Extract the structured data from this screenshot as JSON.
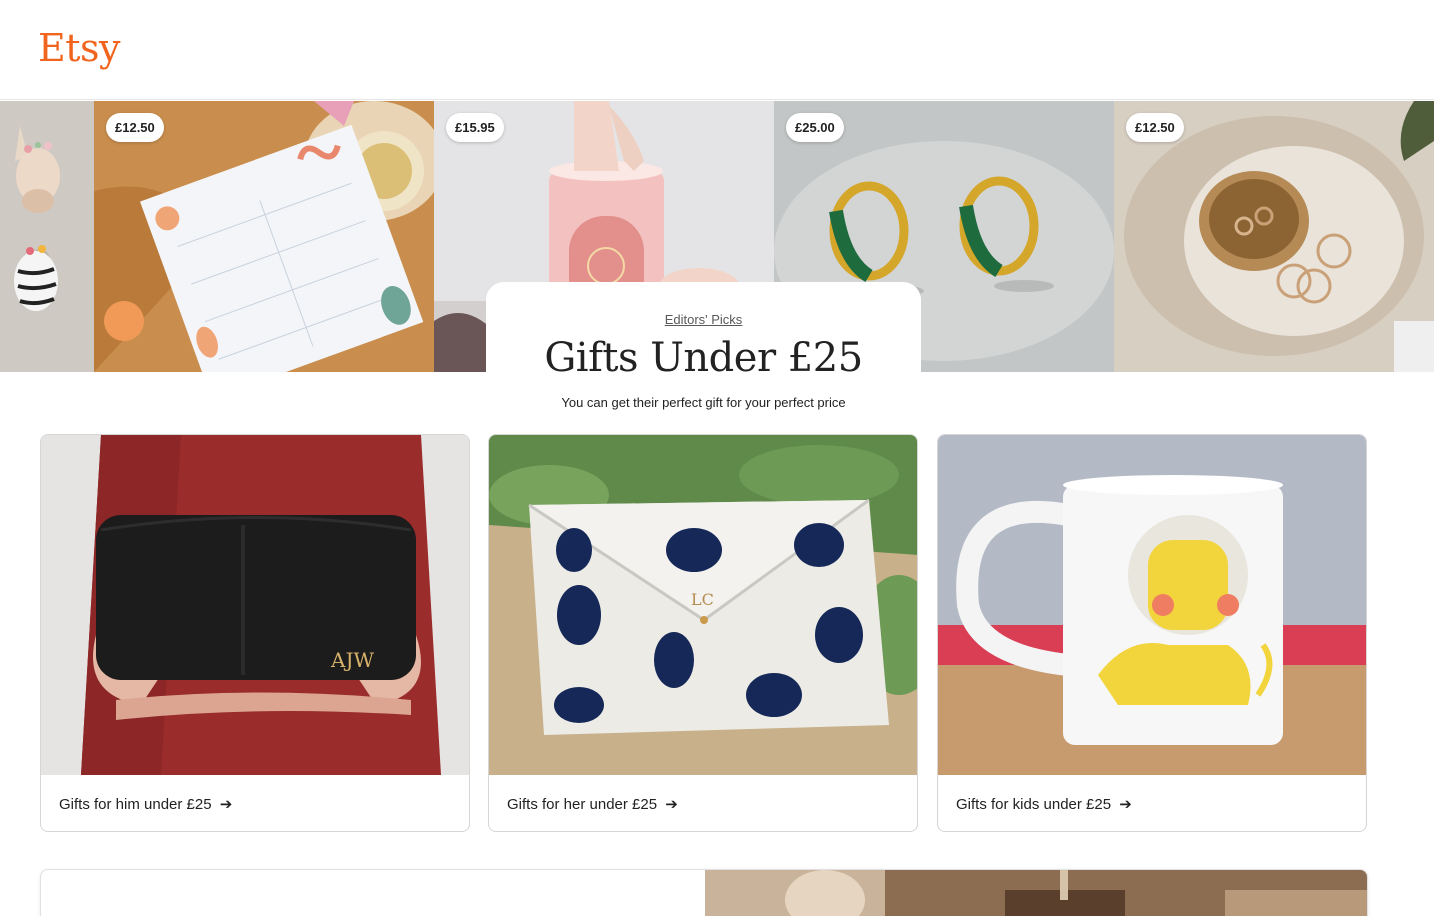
{
  "brand": {
    "logo_text": "Etsy",
    "color": "#F1641E"
  },
  "hero": {
    "tiles": [
      {
        "name": "plush-animal-heads",
        "price": ""
      },
      {
        "name": "weekly-planner",
        "price": "£12.50"
      },
      {
        "name": "candle",
        "price": "£15.95"
      },
      {
        "name": "emerald-earrings",
        "price": "£25.00"
      },
      {
        "name": "ring-dish",
        "price": "£12.50"
      }
    ]
  },
  "editors": {
    "link": "Editors' Picks",
    "title": "Gifts Under £25",
    "subtitle": "You can get their perfect gift for your perfect price"
  },
  "cards": [
    {
      "label": "Gifts for him under £25",
      "arrow": "➔",
      "image": "leather-wash-bag"
    },
    {
      "label": "Gifts for her under £25",
      "arrow": "➔",
      "image": "polka-dot-pouch"
    },
    {
      "label": "Gifts for kids under £25",
      "arrow": "➔",
      "image": "lion-mug"
    }
  ],
  "monograms": {
    "bag": "AJW",
    "pouch": "LC"
  }
}
